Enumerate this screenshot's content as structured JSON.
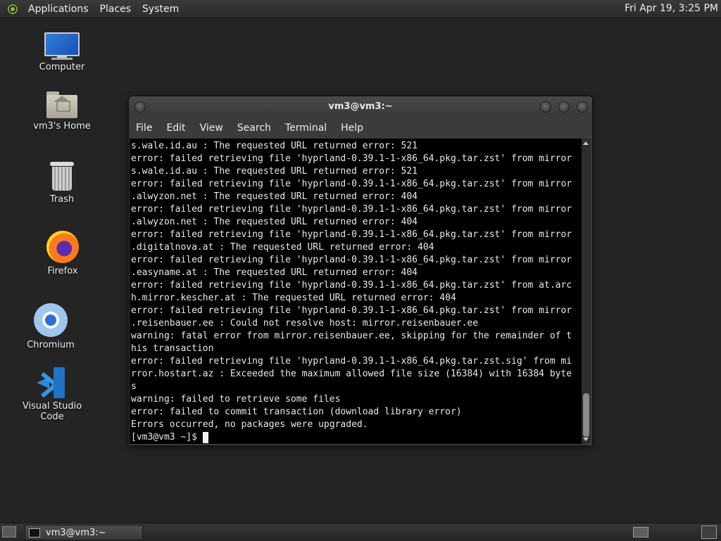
{
  "top_panel": {
    "menus": [
      "Applications",
      "Places",
      "System"
    ],
    "clock": "Fri Apr 19,  3:25 PM"
  },
  "desktop_icons": {
    "computer": "Computer",
    "home": "vm3's Home",
    "trash": "Trash",
    "firefox": "Firefox",
    "chromium": "Chromium",
    "vscode": "Visual Studio Code"
  },
  "terminal": {
    "title": "vm3@vm3:~",
    "menu": [
      "File",
      "Edit",
      "View",
      "Search",
      "Terminal",
      "Help"
    ],
    "lines": [
      "s.wale.id.au : The requested URL returned error: 521",
      "error: failed retrieving file 'hyprland-0.39.1-1-x86_64.pkg.tar.zst' from mirror",
      "s.wale.id.au : The requested URL returned error: 521",
      "error: failed retrieving file 'hyprland-0.39.1-1-x86_64.pkg.tar.zst' from mirror",
      ".alwyzon.net : The requested URL returned error: 404",
      "error: failed retrieving file 'hyprland-0.39.1-1-x86_64.pkg.tar.zst' from mirror",
      ".alwyzon.net : The requested URL returned error: 404",
      "error: failed retrieving file 'hyprland-0.39.1-1-x86_64.pkg.tar.zst' from mirror",
      ".digitalnova.at : The requested URL returned error: 404",
      "error: failed retrieving file 'hyprland-0.39.1-1-x86_64.pkg.tar.zst' from mirror",
      ".easyname.at : The requested URL returned error: 404",
      "error: failed retrieving file 'hyprland-0.39.1-1-x86_64.pkg.tar.zst' from at.arc",
      "h.mirror.kescher.at : The requested URL returned error: 404",
      "error: failed retrieving file 'hyprland-0.39.1-1-x86_64.pkg.tar.zst' from mirror",
      ".reisenbauer.ee : Could not resolve host: mirror.reisenbauer.ee",
      "warning: fatal error from mirror.reisenbauer.ee, skipping for the remainder of t",
      "his transaction",
      "error: failed retrieving file 'hyprland-0.39.1-1-x86_64.pkg.tar.zst.sig' from mi",
      "rror.hostart.az : Exceeded the maximum allowed file size (16384) with 16384 byte",
      "s",
      "warning: failed to retrieve some files",
      "error: failed to commit transaction (download library error)",
      "Errors occurred, no packages were upgraded."
    ],
    "prompt": "[vm3@vm3 ~]$ "
  },
  "bottom_panel": {
    "task_label": "vm3@vm3:~"
  }
}
